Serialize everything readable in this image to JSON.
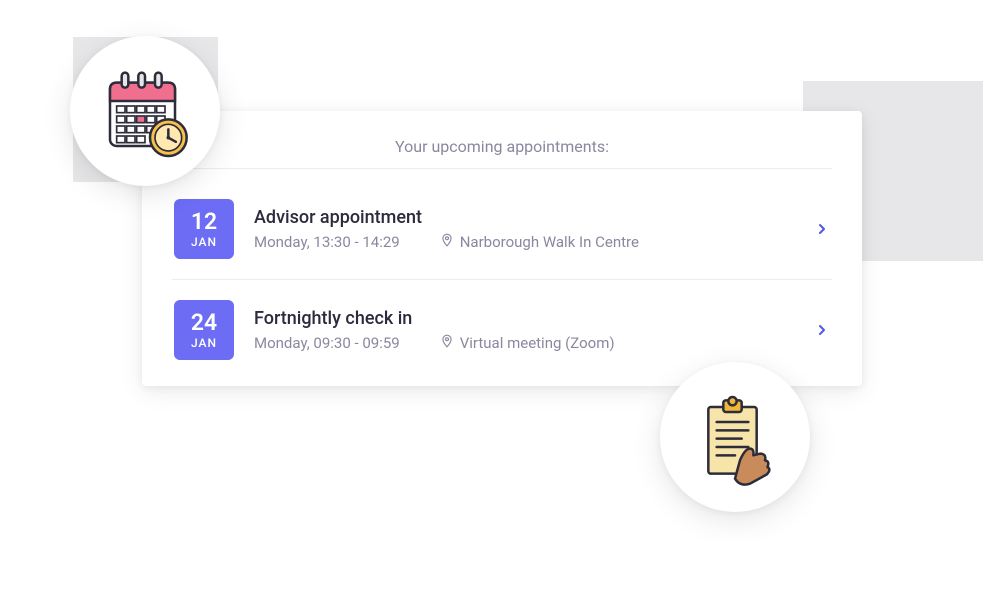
{
  "title": "Your upcoming appointments:",
  "colors": {
    "badge": "#6c6cf4",
    "chevron": "#5457e8",
    "muted": "#8a88a0",
    "text": "#2d2a3d"
  },
  "appointments": [
    {
      "day": "12",
      "month": "JAN",
      "title": "Advisor appointment",
      "time": "Monday, 13:30 - 14:29",
      "location": "Narborough Walk In Centre"
    },
    {
      "day": "24",
      "month": "JAN",
      "title": "Fortnightly check in",
      "time": "Monday, 09:30 - 09:59",
      "location": "Virtual meeting (Zoom)"
    }
  ],
  "icons": {
    "top_left": "calendar-clock-icon",
    "bottom_right": "clipboard-hand-icon"
  }
}
